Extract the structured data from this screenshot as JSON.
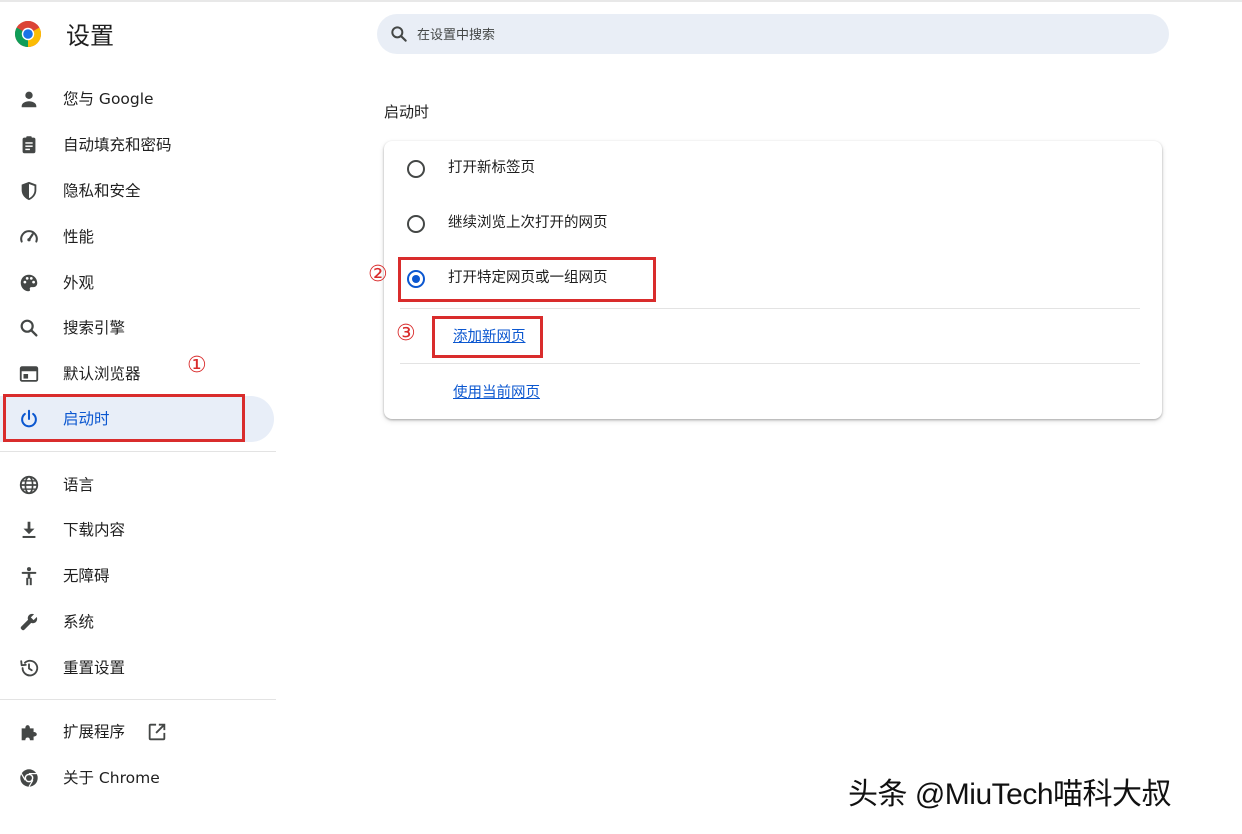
{
  "header": {
    "title": "设置",
    "search_placeholder": "在设置中搜索"
  },
  "sidebar": {
    "items": [
      {
        "label": "您与 Google",
        "icon": "person-icon"
      },
      {
        "label": "自动填充和密码",
        "icon": "clipboard-icon"
      },
      {
        "label": "隐私和安全",
        "icon": "shield-icon"
      },
      {
        "label": "性能",
        "icon": "speedometer-icon"
      },
      {
        "label": "外观",
        "icon": "palette-icon"
      },
      {
        "label": "搜索引擎",
        "icon": "search-icon"
      },
      {
        "label": "默认浏览器",
        "icon": "browser-window-icon"
      },
      {
        "label": "启动时",
        "icon": "power-icon",
        "active": true
      },
      {
        "label": "语言",
        "icon": "globe-icon"
      },
      {
        "label": "下载内容",
        "icon": "download-icon"
      },
      {
        "label": "无障碍",
        "icon": "accessibility-icon"
      },
      {
        "label": "系统",
        "icon": "wrench-icon"
      },
      {
        "label": "重置设置",
        "icon": "history-icon"
      },
      {
        "label": "扩展程序",
        "icon": "puzzle-icon"
      },
      {
        "label": "关于 Chrome",
        "icon": "chrome-icon"
      }
    ]
  },
  "main": {
    "section_title": "启动时",
    "options": [
      {
        "label": "打开新标签页",
        "selected": false
      },
      {
        "label": "继续浏览上次打开的网页",
        "selected": false
      },
      {
        "label": "打开特定网页或一组网页",
        "selected": true
      }
    ],
    "add_page_link": "添加新网页",
    "use_current_link": "使用当前网页"
  },
  "annotations": {
    "n1": "①",
    "n2": "②",
    "n3": "③",
    "color": "#d92c2c"
  },
  "watermark": "头条 @MiuTech喵科大叔",
  "colors": {
    "accent": "#0b57d0",
    "active_bg": "#e8eef8",
    "search_bg": "#e9eef6"
  }
}
